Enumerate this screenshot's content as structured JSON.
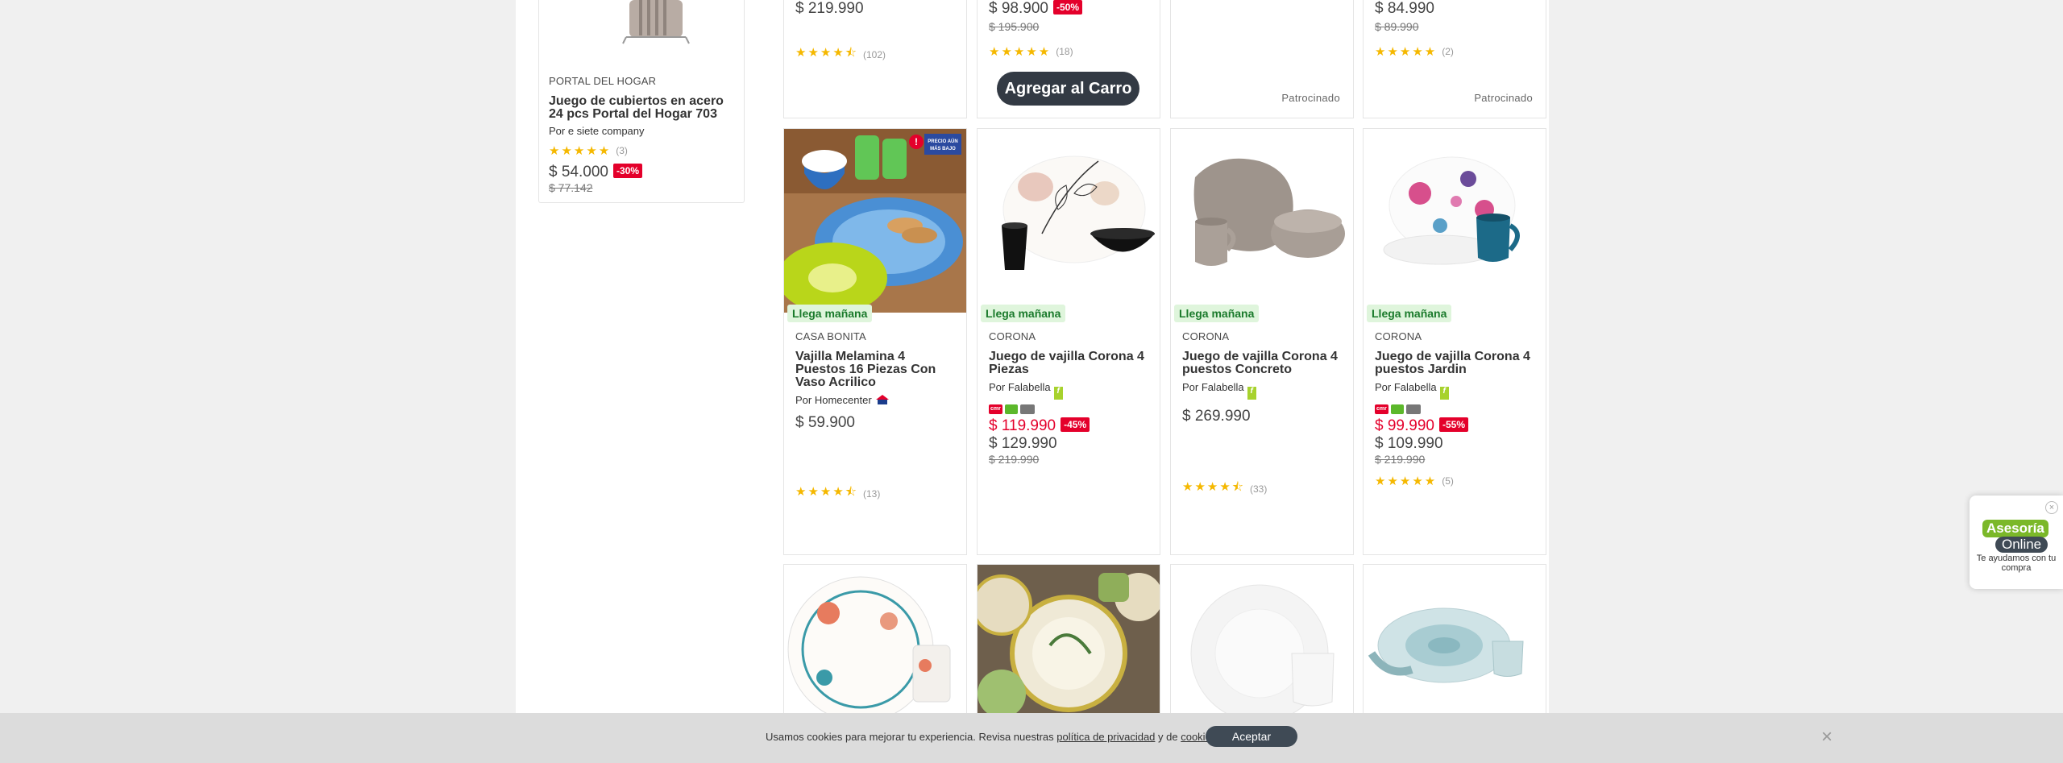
{
  "side_card": {
    "brand": "PORTAL DEL HOGAR",
    "name": "Juego de cubiertos en acero 24 pcs Portal del Hogar 703",
    "seller": "Por e siete company",
    "rating_count": "(3)",
    "price": "$ 54.000",
    "discount": "-30%",
    "old_price": "$ 77.142"
  },
  "top_row": [
    {
      "price": "$ 219.990",
      "rating_count": "(102)"
    },
    {
      "price": "$ 98.900",
      "discount": "-50%",
      "old_price": "$ 195.900",
      "rating_count": "(18)",
      "add_to_cart": "Agregar al Carro"
    },
    {
      "sponsored": "Patrocinado"
    },
    {
      "price": "$ 84.990",
      "old_price": "$ 89.990",
      "rating_count": "(2)",
      "sponsored": "Patrocinado"
    }
  ],
  "products": [
    {
      "brand": "CASA BONITA",
      "name": "Vajilla Melamina 4 Puestos 16 Piezas Con Vaso Acrilico",
      "seller": "Por Homecenter",
      "price": "$ 59.900",
      "rating_count": "(13)",
      "delivery": "Llega mañana",
      "tag_line1": "PRECIO AÚN",
      "tag_line2": "MÁS BAJO"
    },
    {
      "brand": "CORONA",
      "name": "Juego de vajilla Corona 4 Piezas",
      "seller": "Por Falabella",
      "price_cmr": "$ 119.990",
      "discount": "-45%",
      "price": "$ 129.990",
      "old_price": "$ 219.990",
      "delivery": "Llega mañana"
    },
    {
      "brand": "CORONA",
      "name": "Juego de vajilla Corona 4 puestos Concreto",
      "seller": "Por Falabella",
      "price": "$ 269.990",
      "rating_count": "(33)",
      "delivery": "Llega mañana"
    },
    {
      "brand": "CORONA",
      "name": "Juego de vajilla Corona 4 puestos Jardin",
      "seller": "Por Falabella",
      "price_cmr": "$ 99.990",
      "discount": "-55%",
      "price": "$ 109.990",
      "old_price": "$ 219.990",
      "rating_count": "(5)",
      "delivery": "Llega mañana"
    }
  ],
  "cookie": {
    "text_before": "Usamos cookies para mejorar tu experiencia. Revisa nuestras ",
    "privacy_link": "política de privacidad",
    "text_middle": " y de ",
    "cookies_link": "cookies",
    "text_after": ".",
    "accept": "Aceptar",
    "close": "×"
  },
  "chat": {
    "line1": "Asesoría",
    "line2": "Online",
    "line3": "Te ayudamos con tu compra",
    "close": "×"
  },
  "icons": {
    "stars": "★★★★★",
    "stars_half": "★★★★⯪"
  },
  "colors": {
    "discount_red": "#e4002b",
    "delivery_green": "#dff5dc",
    "star_yellow": "#f5b800",
    "cart_button": "#333a44"
  }
}
